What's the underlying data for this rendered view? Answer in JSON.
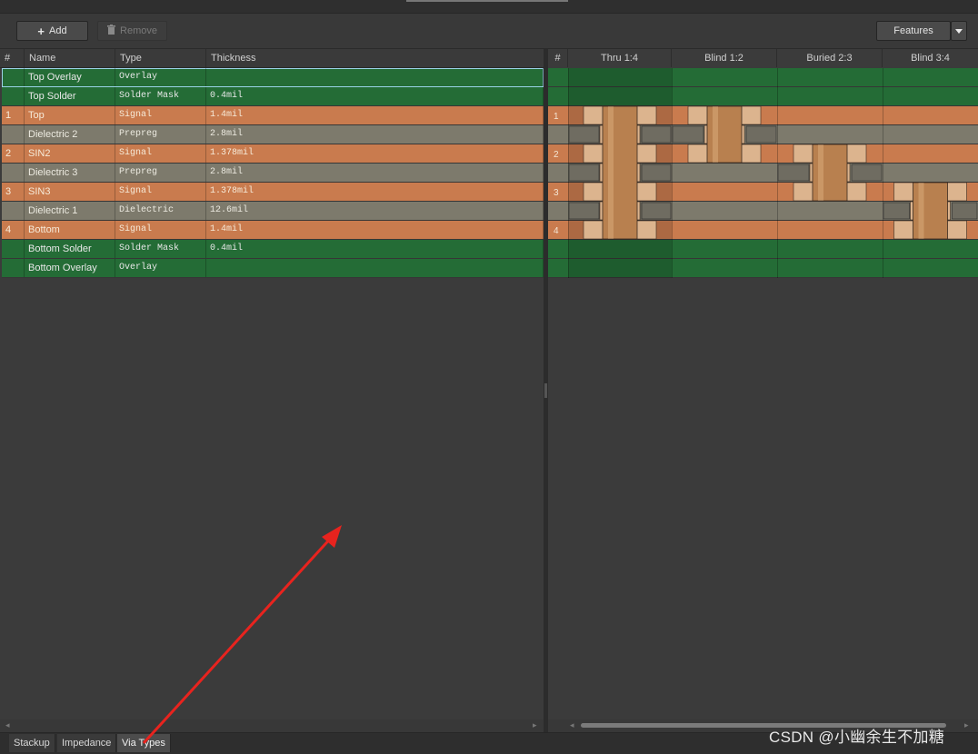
{
  "toolbar": {
    "add_label": "Add",
    "remove_label": "Remove",
    "features_label": "Features"
  },
  "left_grid": {
    "columns": [
      "#",
      "Name",
      "Type",
      "Thickness"
    ],
    "rows": [
      {
        "num": "",
        "name": "Top Overlay",
        "type": "Overlay",
        "thickness": "",
        "kind": "overlay"
      },
      {
        "num": "",
        "name": "Top Solder",
        "type": "Solder Mask",
        "thickness": "0.4mil",
        "kind": "soldermask"
      },
      {
        "num": "1",
        "name": "Top",
        "type": "Signal",
        "thickness": "1.4mil",
        "kind": "signal"
      },
      {
        "num": "",
        "name": "Dielectric 2",
        "type": "Prepreg",
        "thickness": "2.8mil",
        "kind": "dielectric"
      },
      {
        "num": "2",
        "name": "SIN2",
        "type": "Signal",
        "thickness": "1.378mil",
        "kind": "signal"
      },
      {
        "num": "",
        "name": "Dielectric 3",
        "type": "Prepreg",
        "thickness": "2.8mil",
        "kind": "dielectric"
      },
      {
        "num": "3",
        "name": "SIN3",
        "type": "Signal",
        "thickness": "1.378mil",
        "kind": "signal"
      },
      {
        "num": "",
        "name": "Dielectric 1",
        "type": "Dielectric",
        "thickness": "12.6mil",
        "kind": "dielectric"
      },
      {
        "num": "4",
        "name": "Bottom",
        "type": "Signal",
        "thickness": "1.4mil",
        "kind": "signal"
      },
      {
        "num": "",
        "name": "Bottom Solder",
        "type": "Solder Mask",
        "thickness": "0.4mil",
        "kind": "soldermask"
      },
      {
        "num": "",
        "name": "Bottom Overlay",
        "type": "Overlay",
        "thickness": "",
        "kind": "overlay"
      }
    ]
  },
  "via_grid": {
    "hash_label": "#",
    "via_types": [
      {
        "label": "Thru 1:4",
        "from": 1,
        "to": 4
      },
      {
        "label": "Blind 1:2",
        "from": 1,
        "to": 2
      },
      {
        "label": "Buried 2:3",
        "from": 2,
        "to": 3
      },
      {
        "label": "Blind 3:4",
        "from": 3,
        "to": 4
      }
    ]
  },
  "bottom_tabs": [
    {
      "label": "Stackup",
      "active": false
    },
    {
      "label": "Impedance",
      "active": false
    },
    {
      "label": "Via Types",
      "active": true
    }
  ],
  "watermark": "CSDN @小幽余生不加糖",
  "colors": {
    "overlay": "#246c36",
    "signal": "#c97b4e",
    "dielectric": "#7d7a6c",
    "barrel": "#b8804f",
    "pad": "#dcb48e",
    "annotation_arrow": "#e8231e"
  },
  "icons": {
    "add": "plus-icon",
    "remove": "trash-icon",
    "features_dropdown": "chevron-down-icon"
  }
}
